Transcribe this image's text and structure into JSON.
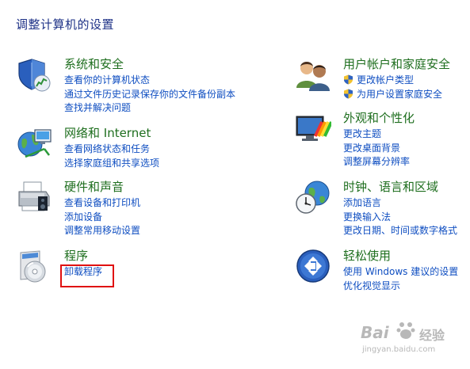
{
  "page_title": "调整计算机的设置",
  "categories": {
    "system": {
      "heading": "系统和安全",
      "links": [
        "查看你的计算机状态",
        "通过文件历史记录保存你的文件备份副本",
        "查找并解决问题"
      ]
    },
    "network": {
      "heading": "网络和 Internet",
      "links": [
        "查看网络状态和任务",
        "选择家庭组和共享选项"
      ]
    },
    "hardware": {
      "heading": "硬件和声音",
      "links": [
        "查看设备和打印机",
        "添加设备",
        "调整常用移动设置"
      ]
    },
    "programs": {
      "heading": "程序",
      "links": [
        "卸载程序"
      ]
    },
    "users": {
      "heading": "用户帐户和家庭安全",
      "links": [
        "更改帐户类型",
        "为用户设置家庭安全"
      ]
    },
    "appearance": {
      "heading": "外观和个性化",
      "links": [
        "更改主题",
        "更改桌面背景",
        "调整屏幕分辨率"
      ]
    },
    "clock": {
      "heading": "时钟、语言和区域",
      "links": [
        "添加语言",
        "更换输入法",
        "更改日期、时间或数字格式"
      ]
    },
    "ease": {
      "heading": "轻松使用",
      "links": [
        "使用 Windows 建议的设置",
        "优化视觉显示"
      ]
    }
  },
  "watermark": {
    "brand": "Bai",
    "brand_cn": "经验",
    "domain": "jingyan.baidu.com"
  },
  "colors": {
    "title": "#1e3287",
    "heading": "#1e6e1e",
    "link": "#0f4ec1",
    "highlight": "#e01010"
  }
}
